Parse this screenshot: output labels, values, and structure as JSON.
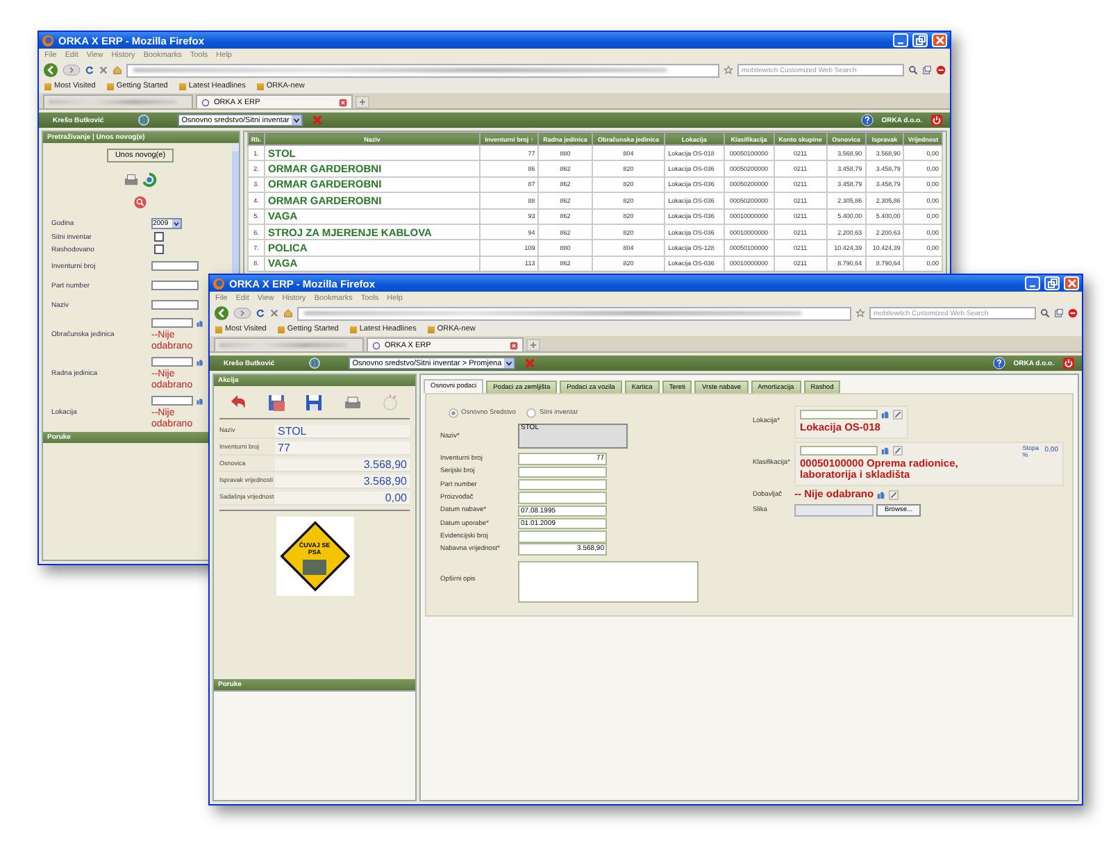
{
  "windows": [
    {
      "kind": "list",
      "title": "ORKA X ERP - Mozilla Firefox",
      "menu": [
        "File",
        "Edit",
        "View",
        "History",
        "Bookmarks",
        "Tools",
        "Help"
      ],
      "search_placeholder": "mobilewitch Customized Web Search",
      "bookmarks": [
        "Most Visited",
        "Getting Started",
        "Latest Headlines",
        "ORKA-new"
      ],
      "tab_label": "ORKA X ERP",
      "app": {
        "user": "Krešo Butković",
        "module": "Osnovno sredstvo/Sitni inventar",
        "company": "ORKA d.o.o."
      },
      "search_panel": {
        "title": "Pretraživanje | Unos novog(e)",
        "button": "Unos novog(e)",
        "filters": [
          {
            "label": "Godina",
            "kind": "select",
            "value": "2009"
          },
          {
            "label": "Sitni inventar",
            "kind": "checkbox",
            "checked": false
          },
          {
            "label": "Rashodovano",
            "kind": "checkbox",
            "checked": false
          },
          {
            "label": "Inventurni broj",
            "kind": "text"
          },
          {
            "label": "Part number",
            "kind": "text"
          },
          {
            "label": "Naziv",
            "kind": "text"
          },
          {
            "label": "Obračunska jedinica",
            "kind": "picker",
            "value": "--Nije odabrano"
          },
          {
            "label": "Radna jedinica",
            "kind": "picker",
            "value": "--Nije odabrano"
          },
          {
            "label": "Lokacija",
            "kind": "picker",
            "value": "--Nije odabrano"
          }
        ]
      },
      "messages_title": "Poruke",
      "table": {
        "columns": [
          "Rb.",
          "Naziv",
          "Inventurni broj ↑",
          "Radna jedinica",
          "Obračunska jedinica",
          "Lokacija",
          "Klasifikacija",
          "Konto skupine",
          "Osnovica",
          "Ispravak",
          "Vrijednost"
        ],
        "rows": [
          [
            "1.",
            "STOL",
            "77",
            "880",
            "804",
            "Lokacija OS-018",
            "00050100000",
            "0211",
            "3.568,90",
            "3.568,90",
            "0,00"
          ],
          [
            "2.",
            "ORMAR GARDEROBNI",
            "86",
            "862",
            "820",
            "Lokacija OS-036",
            "00050200000",
            "0211",
            "3.458,79",
            "3.458,79",
            "0,00"
          ],
          [
            "3.",
            "ORMAR GARDEROBNI",
            "87",
            "862",
            "820",
            "Lokacija OS-036",
            "00050200000",
            "0211",
            "3.458,79",
            "3.458,79",
            "0,00"
          ],
          [
            "4.",
            "ORMAR GARDEROBNI",
            "88",
            "862",
            "820",
            "Lokacija OS-036",
            "00050200000",
            "0211",
            "2.305,86",
            "2.305,86",
            "0,00"
          ],
          [
            "5.",
            "VAGA",
            "93",
            "862",
            "820",
            "Lokacija OS-036",
            "00010000000",
            "0211",
            "5.400,00",
            "5.400,00",
            "0,00"
          ],
          [
            "6.",
            "STROJ ZA MJERENJE KABLOVA",
            "94",
            "862",
            "820",
            "Lokacija OS-036",
            "00010000000",
            "0211",
            "2.200,63",
            "2.200,63",
            "0,00"
          ],
          [
            "7.",
            "POLICA",
            "109",
            "880",
            "804",
            "Lokacija OS-128",
            "00050100000",
            "0211",
            "10.424,39",
            "10.424,39",
            "0,00"
          ],
          [
            "8.",
            "VAGA",
            "113",
            "862",
            "820",
            "Lokacija OS-036",
            "00010000000",
            "0211",
            "8.790,64",
            "8.790,64",
            "0,00"
          ]
        ]
      }
    },
    {
      "kind": "edit",
      "title": "ORKA X ERP - Mozilla Firefox",
      "menu": [
        "File",
        "Edit",
        "View",
        "History",
        "Bookmarks",
        "Tools",
        "Help"
      ],
      "search_placeholder": "mobilewitch Customized Web Search",
      "bookmarks": [
        "Most Visited",
        "Getting Started",
        "Latest Headlines",
        "ORKA-new"
      ],
      "tab_label": "ORKA X ERP",
      "app": {
        "user": "Krešo Butković",
        "module": "Osnovno sredstvo/Sitni inventar > Promjena",
        "company": "ORKA d.o.o."
      },
      "action_panel": {
        "title": "Akcija",
        "info": [
          {
            "label": "Naziv",
            "kind": "text",
            "value": "STOL"
          },
          {
            "label": "Inventurni broj",
            "kind": "text",
            "value": "77"
          },
          {
            "label": "Osnovica",
            "kind": "money",
            "value": "3.568,90"
          },
          {
            "label": "Ispravak vrijednosti",
            "kind": "money",
            "value": "3.568,90"
          },
          {
            "label": "Sadašnja vrijednost",
            "kind": "money",
            "value": "0,00"
          }
        ],
        "sign_text": "ČUVAJ SE PSA"
      },
      "messages_title": "Poruke",
      "tabs": [
        {
          "label": "Osnovni podaci",
          "selected": true
        },
        {
          "label": "Podaci za zemljišta",
          "selected": false
        },
        {
          "label": "Podaci za vozila",
          "selected": false
        },
        {
          "label": "Kartica",
          "selected": false
        },
        {
          "label": "Tereti",
          "selected": false
        },
        {
          "label": "Vrste nabave",
          "selected": false
        },
        {
          "label": "Amortizacija",
          "selected": false
        },
        {
          "label": "Rashod",
          "selected": false
        }
      ],
      "type_options": [
        {
          "label": "Osnovno Sredstvo",
          "selected": true
        },
        {
          "label": "Sitni inventar",
          "selected": false
        }
      ],
      "left_fields": [
        {
          "label": "Naziv*",
          "kind": "locked",
          "value": "STOL"
        },
        {
          "label": "Inventurni broj",
          "kind": "number",
          "value": "77"
        },
        {
          "label": "Serijski broj",
          "kind": "text"
        },
        {
          "label": "Part number",
          "kind": "text"
        },
        {
          "label": "Proizvođač",
          "kind": "text"
        },
        {
          "label": "Datum nabave*",
          "kind": "text",
          "value": "07.08.1995"
        },
        {
          "label": "Datum uporabe*",
          "kind": "text",
          "value": "01.01.2009"
        },
        {
          "label": "Evidencijski broj",
          "kind": "text"
        },
        {
          "label": "Nabavna vrijednost*",
          "kind": "number",
          "value": "3.568,90"
        },
        {
          "label": "Opširni opis",
          "kind": "textarea"
        }
      ],
      "right_fields": [
        {
          "label": "Lokacija*",
          "kind": "picker",
          "value": "Lokacija OS-018"
        },
        {
          "label": "Klasifikacija*",
          "kind": "picker",
          "value": "00050100000 Oprema radionice, laboratorija i skladišta",
          "rate_label": "Stopa %",
          "rate": "0,00"
        },
        {
          "label": "Dobavljač",
          "kind": "inline",
          "value": "-- Nije odabrano"
        },
        {
          "label": "Slika",
          "kind": "file",
          "button": "Browse..."
        }
      ]
    }
  ]
}
